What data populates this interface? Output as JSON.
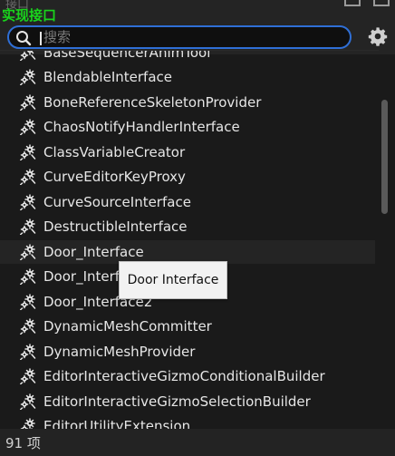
{
  "header": {
    "ghost_title": "接口",
    "title": "实现接口"
  },
  "search": {
    "placeholder": "搜索",
    "value": ""
  },
  "list": {
    "items": [
      "BaseSequencerAnimTool",
      "BlendableInterface",
      "BoneReferenceSkeletonProvider",
      "ChaosNotifyHandlerInterface",
      "ClassVariableCreator",
      "CurveEditorKeyProxy",
      "CurveSourceInterface",
      "DestructibleInterface",
      "Door_Interface",
      "Door_Interface1",
      "Door_Interface2",
      "DynamicMeshCommitter",
      "DynamicMeshProvider",
      "EditorInteractiveGizmoConditionalBuilder",
      "EditorInteractiveGizmoSelectionBuilder",
      "EditorUtilityExtension"
    ],
    "hovered_index": 8,
    "item_icon": "interface-gears-icon"
  },
  "tooltip": {
    "text": "Door Interface"
  },
  "status": {
    "count_text": "91 项"
  },
  "colors": {
    "accent": "#2f6fd6",
    "title_green": "#19d41c",
    "background": "#1a1a1a"
  }
}
